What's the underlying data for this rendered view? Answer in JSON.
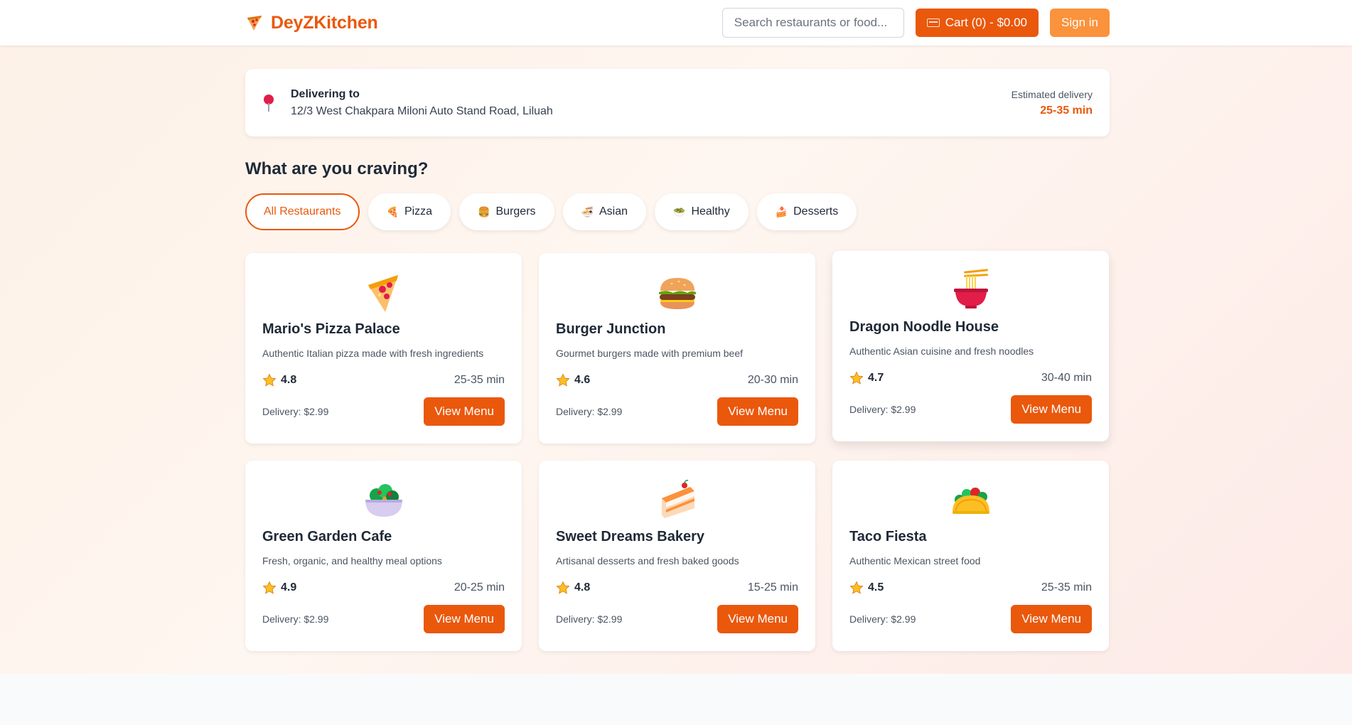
{
  "app": {
    "name": "DeyZKitchen",
    "logo_icon": "pizza-slice-icon",
    "brand_color": "#ea580c"
  },
  "header": {
    "search_placeholder": "Search restaurants or food...",
    "cart_label": "Cart (0) - $0.00",
    "cart_icon": "cart-icon",
    "signin_label": "Sign in"
  },
  "delivery": {
    "label": "Delivering to",
    "address": "12/3 West Chakpara Miloni Auto Stand Road, Liluah",
    "estimated_label": "Estimated delivery",
    "estimated_time": "25-35 min",
    "icon": "location-pin-icon"
  },
  "section": {
    "title": "What are you craving?"
  },
  "categories": [
    {
      "label": "All Restaurants",
      "emoji": "",
      "active": true
    },
    {
      "label": "Pizza",
      "emoji": "🍕",
      "active": false
    },
    {
      "label": "Burgers",
      "emoji": "🍔",
      "active": false
    },
    {
      "label": "Asian",
      "emoji": "🍜",
      "active": false
    },
    {
      "label": "Healthy",
      "emoji": "🥗",
      "active": false
    },
    {
      "label": "Desserts",
      "emoji": "🍰",
      "active": false
    }
  ],
  "restaurants": [
    {
      "name": "Mario's Pizza Palace",
      "description": "Authentic Italian pizza made with fresh ingredients",
      "rating": "4.8",
      "eta": "25-35 min",
      "delivery_fee": "Delivery: $2.99",
      "button": "View Menu",
      "icon": "pizza-icon"
    },
    {
      "name": "Burger Junction",
      "description": "Gourmet burgers made with premium beef",
      "rating": "4.6",
      "eta": "20-30 min",
      "delivery_fee": "Delivery: $2.99",
      "button": "View Menu",
      "icon": "burger-icon"
    },
    {
      "name": "Dragon Noodle House",
      "description": "Authentic Asian cuisine and fresh noodles",
      "rating": "4.7",
      "eta": "30-40 min",
      "delivery_fee": "Delivery: $2.99",
      "button": "View Menu",
      "icon": "noodle-bowl-icon"
    },
    {
      "name": "Green Garden Cafe",
      "description": "Fresh, organic, and healthy meal options",
      "rating": "4.9",
      "eta": "20-25 min",
      "delivery_fee": "Delivery: $2.99",
      "button": "View Menu",
      "icon": "salad-icon"
    },
    {
      "name": "Sweet Dreams Bakery",
      "description": "Artisanal desserts and fresh baked goods",
      "rating": "4.8",
      "eta": "15-25 min",
      "delivery_fee": "Delivery: $2.99",
      "button": "View Menu",
      "icon": "cake-icon"
    },
    {
      "name": "Taco Fiesta",
      "description": "Authentic Mexican street food",
      "rating": "4.5",
      "eta": "25-35 min",
      "delivery_fee": "Delivery: $2.99",
      "button": "View Menu",
      "icon": "taco-icon"
    }
  ]
}
